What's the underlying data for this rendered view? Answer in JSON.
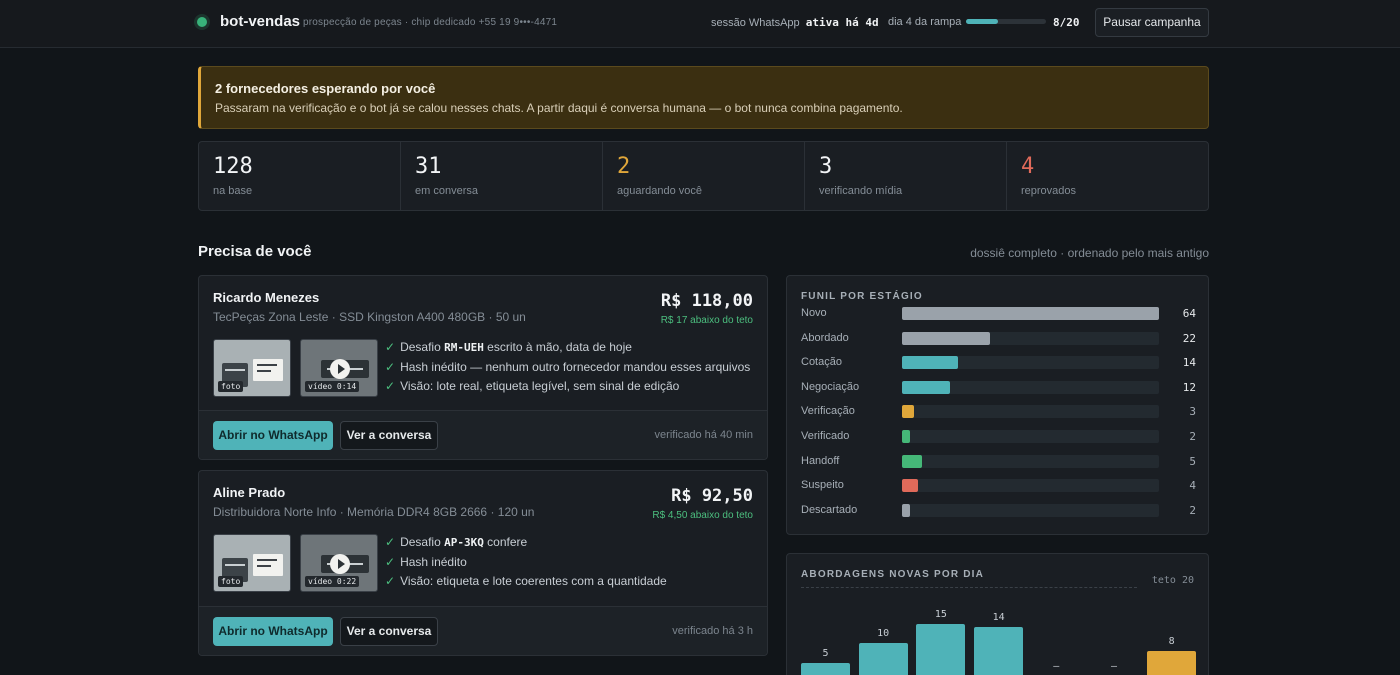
{
  "topbar": {
    "app_name": "bot-vendas",
    "subtitle": "prospecção de peças · chip dedicado +55 19 9•••-4471",
    "session_label": "sessão WhatsApp",
    "session_status": "ativa há 4d",
    "ramp_label": "dia 4 da rampa",
    "ramp_progress": 0.4,
    "ramp_count": "8/20",
    "pause_label": "Pausar campanha",
    "status_color": "#38b27a"
  },
  "alert": {
    "title": "2 fornecedores esperando por você",
    "text": "Passaram na verificação e o bot já se calou nesses chats. A partir daqui é conversa humana — o bot nunca combina pagamento."
  },
  "stats": [
    {
      "value": "128",
      "label": "na base",
      "color": "#f2f4f6"
    },
    {
      "value": "31",
      "label": "em conversa",
      "color": "#f2f4f6"
    },
    {
      "value": "2",
      "label": "aguardando você",
      "color": "#e0a73a"
    },
    {
      "value": "3",
      "label": "verificando mídia",
      "color": "#f2f4f6"
    },
    {
      "value": "4",
      "label": "reprovados",
      "color": "#e06a5a"
    }
  ],
  "section": {
    "title": "Precisa de você",
    "meta": "dossiê completo · ordenado pelo mais antigo"
  },
  "cards": [
    {
      "name": "Ricardo Menezes",
      "desc": "TecPeças Zona Leste · SSD Kingston A400 480GB · 50 un",
      "price": "R$ 118,00",
      "under": "R$ 17 abaixo do teto",
      "thumb_photo": "foto",
      "thumb_video": "vídeo 0:14",
      "checks": [
        {
          "pre": "Desafio ",
          "code": "RM-UEH",
          "post": " escrito à mão, data de hoje"
        },
        {
          "pre": "Hash inédito — nenhum outro fornecedor mandou esses arquivos",
          "code": "",
          "post": ""
        },
        {
          "pre": "Visão: lote real, etiqueta legível, sem sinal de edição",
          "code": "",
          "post": ""
        }
      ],
      "wa_label": "Abrir no WhatsApp",
      "conv_label": "Ver a conversa",
      "verified": "verificado há 40 min"
    },
    {
      "name": "Aline Prado",
      "desc": "Distribuidora Norte Info · Memória DDR4 8GB 2666 · 120 un",
      "price": "R$ 92,50",
      "under": "R$ 4,50 abaixo do teto",
      "thumb_photo": "foto",
      "thumb_video": "vídeo 0:22",
      "checks": [
        {
          "pre": "Desafio ",
          "code": "AP-3KQ",
          "post": " confere"
        },
        {
          "pre": "Hash inédito",
          "code": "",
          "post": ""
        },
        {
          "pre": "Visão: etiqueta e lote coerentes com a quantidade",
          "code": "",
          "post": ""
        }
      ],
      "wa_label": "Abrir no WhatsApp",
      "conv_label": "Ver a conversa",
      "verified": "verificado há 3 h"
    }
  ],
  "chart_data": [
    {
      "type": "bar",
      "title": "FUNIL POR ESTÁGIO",
      "orientation": "horizontal",
      "categories": [
        "Novo",
        "Abordado",
        "Cotação",
        "Negociação",
        "Verificação",
        "Verificado",
        "Handoff",
        "Suspeito",
        "Descartado"
      ],
      "values": [
        64,
        22,
        14,
        12,
        3,
        2,
        5,
        4,
        2
      ],
      "colors": [
        "#9aa2aa",
        "#9aa2aa",
        "#4fb3b8",
        "#4fb3b8",
        "#e0a73a",
        "#45b878",
        "#45b878",
        "#e06a5a",
        "#9aa2aa"
      ],
      "xlim": [
        0,
        64
      ]
    },
    {
      "type": "bar",
      "title": "ABORDAGENS NOVAS POR DIA",
      "cap_label": "teto 20",
      "categories": [
        "",
        "",
        "",
        "",
        "",
        "",
        ""
      ],
      "values": [
        5,
        10,
        15,
        14,
        null,
        null,
        8
      ],
      "value_labels": [
        "5",
        "10",
        "15",
        "14",
        "—",
        "—",
        "8"
      ],
      "colors": [
        "#4fb3b8",
        "#4fb3b8",
        "#4fb3b8",
        "#4fb3b8",
        "#4fb3b8",
        "#4fb3b8",
        "#e0a73a"
      ],
      "ylim": [
        0,
        20
      ]
    }
  ]
}
